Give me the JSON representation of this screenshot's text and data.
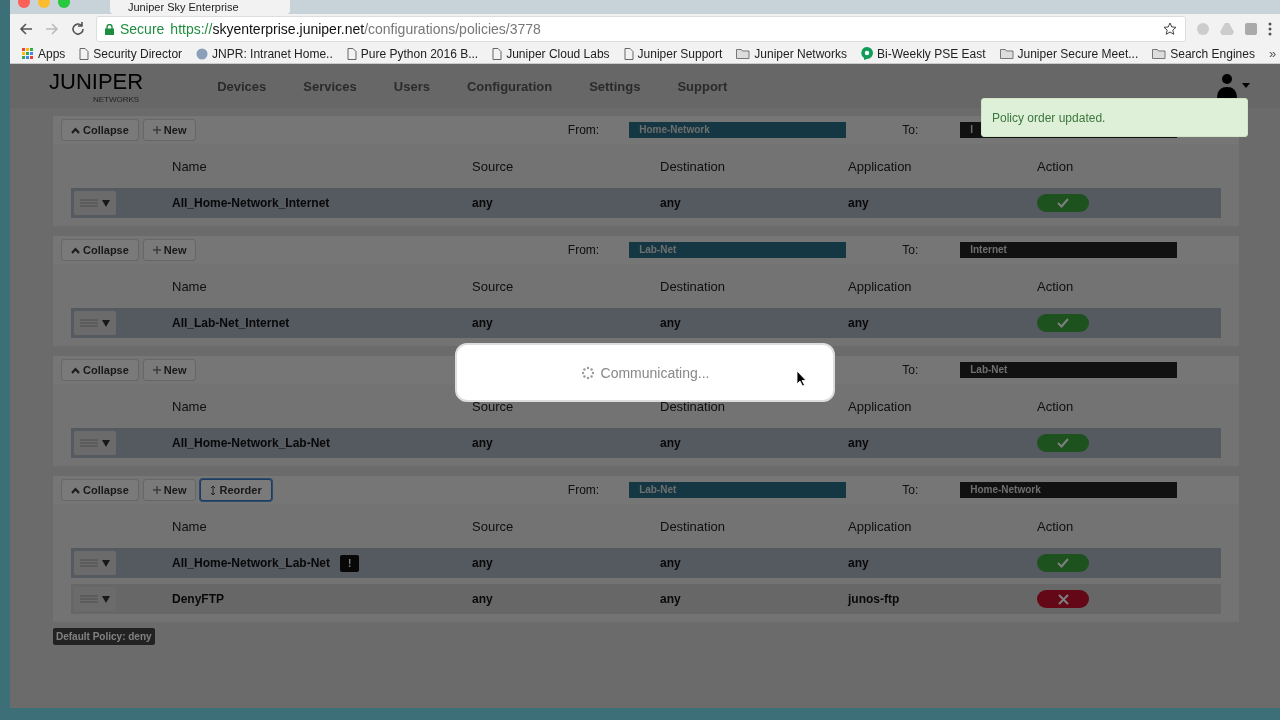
{
  "browser": {
    "tab_title": "Juniper Sky Enterprise",
    "secure_label": "Secure",
    "url_scheme": "https://",
    "url_host": "skyenterprise.juniper.net",
    "url_path": "/configurations/policies/3778",
    "bookmarks": [
      {
        "label": "Apps",
        "kind": "apps"
      },
      {
        "label": "Security Director",
        "kind": "page"
      },
      {
        "label": "JNPR: Intranet Home..",
        "kind": "site"
      },
      {
        "label": "Pure Python 2016 B...",
        "kind": "page"
      },
      {
        "label": "Juniper Cloud Labs",
        "kind": "page"
      },
      {
        "label": "Juniper Support",
        "kind": "page"
      },
      {
        "label": "Juniper Networks",
        "kind": "folder"
      },
      {
        "label": "Bi-Weekly PSE East",
        "kind": "chat"
      },
      {
        "label": "Juniper Secure Meet...",
        "kind": "folder"
      },
      {
        "label": "Search Engines",
        "kind": "folder"
      }
    ],
    "more": "»"
  },
  "app": {
    "logo": "JUNIPER",
    "logo_sub": "NETWORKS",
    "nav": [
      "Devices",
      "Services",
      "Users",
      "Configuration",
      "Settings",
      "Support"
    ]
  },
  "toast": "Policy order updated.",
  "dialog": {
    "message": "Communicating..."
  },
  "sections": [
    {
      "buttons": [
        {
          "label": "Collapse",
          "kind": "collapse"
        },
        {
          "label": "New",
          "kind": "new"
        }
      ],
      "from_label": "From:",
      "from": "Home-Network",
      "to_label": "To:",
      "to": "I",
      "columns": [
        "Name",
        "Source",
        "Destination",
        "Application",
        "Action"
      ],
      "rows": [
        {
          "name": "All_Home-Network_Internet",
          "source": "any",
          "destination": "any",
          "application": "any",
          "kind": "allow",
          "selected": true
        }
      ]
    },
    {
      "buttons": [
        {
          "label": "Collapse",
          "kind": "collapse"
        },
        {
          "label": "New",
          "kind": "new"
        }
      ],
      "from_label": "From:",
      "from": "Lab-Net",
      "to_label": "To:",
      "to": "Internet",
      "columns": [
        "Name",
        "Source",
        "Destination",
        "Application",
        "Action"
      ],
      "rows": [
        {
          "name": "All_Lab-Net_Internet",
          "source": "any",
          "destination": "any",
          "application": "any",
          "kind": "allow",
          "selected": true
        }
      ]
    },
    {
      "buttons": [
        {
          "label": "Collapse",
          "kind": "collapse"
        },
        {
          "label": "New",
          "kind": "new"
        }
      ],
      "to_label": "To:",
      "to": "Lab-Net",
      "columns": [
        "Name",
        "Source",
        "Destination",
        "Application",
        "Action"
      ],
      "rows": [
        {
          "name": "All_Home-Network_Lab-Net",
          "source": "any",
          "destination": "any",
          "application": "any",
          "kind": "allow",
          "selected": true
        }
      ]
    },
    {
      "buttons": [
        {
          "label": "Collapse",
          "kind": "collapse"
        },
        {
          "label": "New",
          "kind": "new"
        },
        {
          "label": "Reorder",
          "kind": "reorder"
        }
      ],
      "from_label": "From:",
      "from": "Lab-Net",
      "to_label": "To:",
      "to": "Home-Network",
      "columns": [
        "Name",
        "Source",
        "Destination",
        "Application",
        "Action"
      ],
      "rows": [
        {
          "name": "All_Home-Network_Lab-Net",
          "badge": "!",
          "source": "any",
          "destination": "any",
          "application": "any",
          "kind": "allow",
          "selected": true
        },
        {
          "name": "DenyFTP",
          "source": "any",
          "destination": "any",
          "application": "junos-ftp",
          "kind": "deny",
          "selected": false
        }
      ]
    }
  ],
  "default_policy": "Default Policy: deny"
}
